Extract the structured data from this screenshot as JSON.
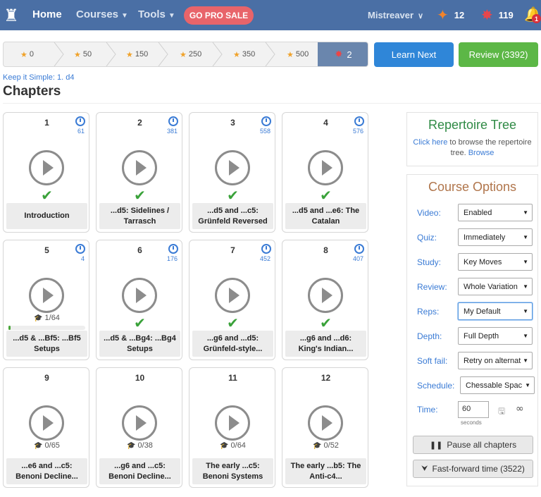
{
  "nav": {
    "home": "Home",
    "courses": "Courses",
    "tools": "Tools",
    "pro": "GO PRO SALE",
    "user": "Mistreaver",
    "stat1": "12",
    "stat2": "119",
    "notifications": "1"
  },
  "progress": {
    "steps": [
      "0",
      "50",
      "150",
      "250",
      "350",
      "500"
    ],
    "current": "2"
  },
  "actions": {
    "learn": "Learn Next",
    "review": "Review (3392)"
  },
  "breadcrumb": "Keep it Simple: 1. d4",
  "heading": "Chapters",
  "chapters": [
    {
      "num": "1",
      "count": "61",
      "title": "Introduction",
      "status": "done"
    },
    {
      "num": "2",
      "count": "381",
      "title": "...d5: Sidelines / Tarrasch",
      "status": "done"
    },
    {
      "num": "3",
      "count": "558",
      "title": "...d5 and ...c5: Grünfeld Reversed",
      "status": "done"
    },
    {
      "num": "4",
      "count": "576",
      "title": "...d5 and ...e6: The Catalan",
      "status": "done"
    },
    {
      "num": "5",
      "count": "4",
      "title": "...d5 & ...Bf5: ...Bf5 Setups",
      "status": "progress",
      "progress": "1/64",
      "fraction": 0.016
    },
    {
      "num": "6",
      "count": "176",
      "title": "...d5 & ...Bg4: ...Bg4 Setups",
      "status": "done"
    },
    {
      "num": "7",
      "count": "452",
      "title": "...g6 and ...d5: Grünfeld-style...",
      "status": "done"
    },
    {
      "num": "8",
      "count": "407",
      "title": "...g6 and ...d6: King's Indian...",
      "status": "done"
    },
    {
      "num": "9",
      "count": "",
      "title": "...e6 and ...c5: Benoni Decline...",
      "status": "progress",
      "progress": "0/65",
      "fraction": 0
    },
    {
      "num": "10",
      "count": "",
      "title": "...g6 and ...c5: Benoni Decline...",
      "status": "progress",
      "progress": "0/38",
      "fraction": 0
    },
    {
      "num": "11",
      "count": "",
      "title": "The early ...c5: Benoni Systems",
      "status": "progress",
      "progress": "0/64",
      "fraction": 0
    },
    {
      "num": "12",
      "count": "",
      "title": "The early ...b5: The Anti-c4...",
      "status": "progress",
      "progress": "0/52",
      "fraction": 0
    }
  ],
  "repertoire": {
    "title": "Repertoire Tree",
    "click_here": "Click here",
    "text": " to browse the repertoire tree. ",
    "browse": "Browse"
  },
  "options": {
    "title": "Course Options",
    "rows": [
      {
        "label": "Video:",
        "value": "Enabled"
      },
      {
        "label": "Quiz:",
        "value": "Immediately"
      },
      {
        "label": "Study:",
        "value": "Key Moves"
      },
      {
        "label": "Review:",
        "value": "Whole Variation"
      },
      {
        "label": "Reps:",
        "value": "My Default"
      },
      {
        "label": "Depth:",
        "value": "Full Depth"
      },
      {
        "label": "Soft fail:",
        "value": "Retry on alternat"
      },
      {
        "label": "Schedule:",
        "value": "Chessable Spac"
      }
    ],
    "time_label": "Time:",
    "time_value": "60",
    "seconds": "seconds",
    "pause": "Pause all chapters",
    "fast_forward": "Fast-forward time (3522)"
  }
}
